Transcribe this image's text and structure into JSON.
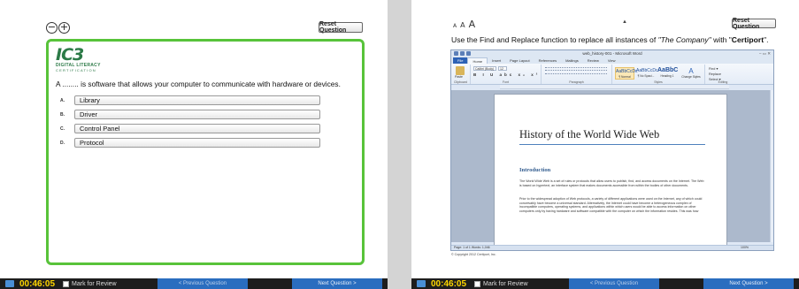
{
  "left": {
    "zoom_out": "−",
    "zoom_in": "+",
    "reset_label": "Reset Question",
    "logo": {
      "main": "IC3",
      "line1": "DIGITAL LITERACY",
      "line2": "CERTIFICATION"
    },
    "question": "A ........ is software that allows your computer to communicate with hardware or devices.",
    "answers": [
      {
        "key": "A.",
        "label": "Library"
      },
      {
        "key": "B.",
        "label": "Driver"
      },
      {
        "key": "C.",
        "label": "Control Panel"
      },
      {
        "key": "D.",
        "label": "Protocol"
      }
    ],
    "accent_color": "#58c33a"
  },
  "right": {
    "font_small": "A",
    "font_medium": "A",
    "font_large": "A",
    "collapse": "▲",
    "reset_label": "Reset Question",
    "instruction_pre": "Use the Find and Replace function to replace all instances of ",
    "instruction_italic": "\"The Company\"",
    "instruction_mid": " with \"",
    "instruction_bold": "Certiport",
    "instruction_post": "\".",
    "copyright": "© Copyright 2012 Certiport, Inc."
  },
  "word": {
    "title": "web_history-001 - Microsoft Word",
    "window_buttons": "–  ▭  ✕",
    "tabs": [
      "File",
      "Home",
      "Insert",
      "Page Layout",
      "References",
      "Mailings",
      "Review",
      "View"
    ],
    "active_tab": "Home",
    "font_name": "Calibri (Body)",
    "font_size": "12",
    "format_buttons": "B I U abc x₂ x²",
    "group_labels": [
      "Clipboard",
      "Font",
      "Paragraph",
      "Styles",
      "Editing"
    ],
    "paste_label": "Paste",
    "styles": [
      {
        "sample": "AaBbCcDc",
        "name": "¶ Normal"
      },
      {
        "sample": "AaBbCcDc",
        "name": "¶ No Spaci..."
      },
      {
        "sample": "AaBbC",
        "name": "Heading 1"
      }
    ],
    "change_styles": "Change Styles",
    "editing": [
      "Find ▾",
      "Replace",
      "Select ▾"
    ],
    "doc_title": "History of the World Wide Web",
    "doc_h2": "Introduction",
    "doc_p1": "The World Wide Web is a set of rules or protocols that allow users to publish, find, and access documents on the Internet. The Web is based on hypertext, an interface system that makes documents accessible from within the bodies of other documents.",
    "doc_p2": "Prior to the widespread adoption of Web protocols, a variety of different applications were used on the Internet, any of which could conceivably have become a universal standard. Alternatively, the Internet could have become a heterogeneous complex of incompatible computers, operating systems, and applications within which users would be able to access information on other computers only by having hardware and software compatible with the computer on which the information resides. This was how",
    "status": "Page: 1 of 1    Words: 1,046",
    "zoom": "100%"
  },
  "bottom_bar": {
    "timer": "00:46:05",
    "mark_label": "Mark for Review",
    "prev_label": "< Previous Question",
    "next_label": "Next Question >"
  }
}
